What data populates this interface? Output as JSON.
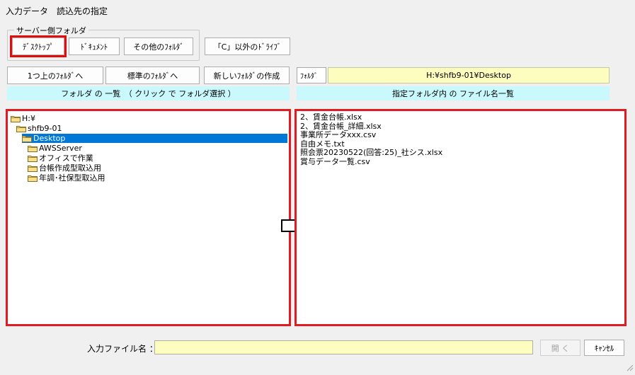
{
  "window": {
    "title": "入力データ　読込先の指定"
  },
  "server_folder_group": {
    "legend": "サーバー側フォルダ",
    "buttons": [
      "ﾃﾞｽｸﾄｯﾌﾟ",
      "ﾄﾞｷｭﾒﾝﾄ",
      "その他のﾌｫﾙﾀﾞ"
    ]
  },
  "other_drive_button": "「C」以外のﾄﾞﾗｲﾌﾞ",
  "nav_buttons": {
    "up": "1つ上のﾌｫﾙﾀﾞへ",
    "standard": "標準のﾌｫﾙﾀﾞへ",
    "new_folder": "新しいﾌｫﾙﾀﾞの作成"
  },
  "folder_label": "ﾌｫﾙﾀﾞ",
  "folder_path": "H:¥shfb9-01¥Desktop",
  "folder_list_header": "フォルダ の 一覧　（ クリック で フォルダ選択 ）",
  "file_list_header": "指定フォルダ内 の ファイル名一覧",
  "folder_tree": [
    {
      "label": "H:¥",
      "level": 0,
      "selected": false
    },
    {
      "label": "shfb9-01",
      "level": 1,
      "selected": false
    },
    {
      "label": "Desktop",
      "level": 2,
      "selected": true
    },
    {
      "label": "AWSServer",
      "level": 3,
      "selected": false
    },
    {
      "label": "オフィスで作業",
      "level": 3,
      "selected": false
    },
    {
      "label": "台帳作成型取込用",
      "level": 3,
      "selected": false
    },
    {
      "label": "年調･社保型取込用",
      "level": 3,
      "selected": false
    }
  ],
  "files": [
    "2、賃金台帳.xlsx",
    "2、賃金台帳_詳細.xlsx",
    "事業所データxxx.csv",
    "自由メモ.txt",
    "照会票20230522(回答:25)_社シス.xlsx",
    "賞与データ一覧.csv"
  ],
  "filename_label": "入力ファイル名 ：",
  "filename_value": "",
  "open_button": "開 く",
  "cancel_button": "ｷｬﾝｾﾙ"
}
